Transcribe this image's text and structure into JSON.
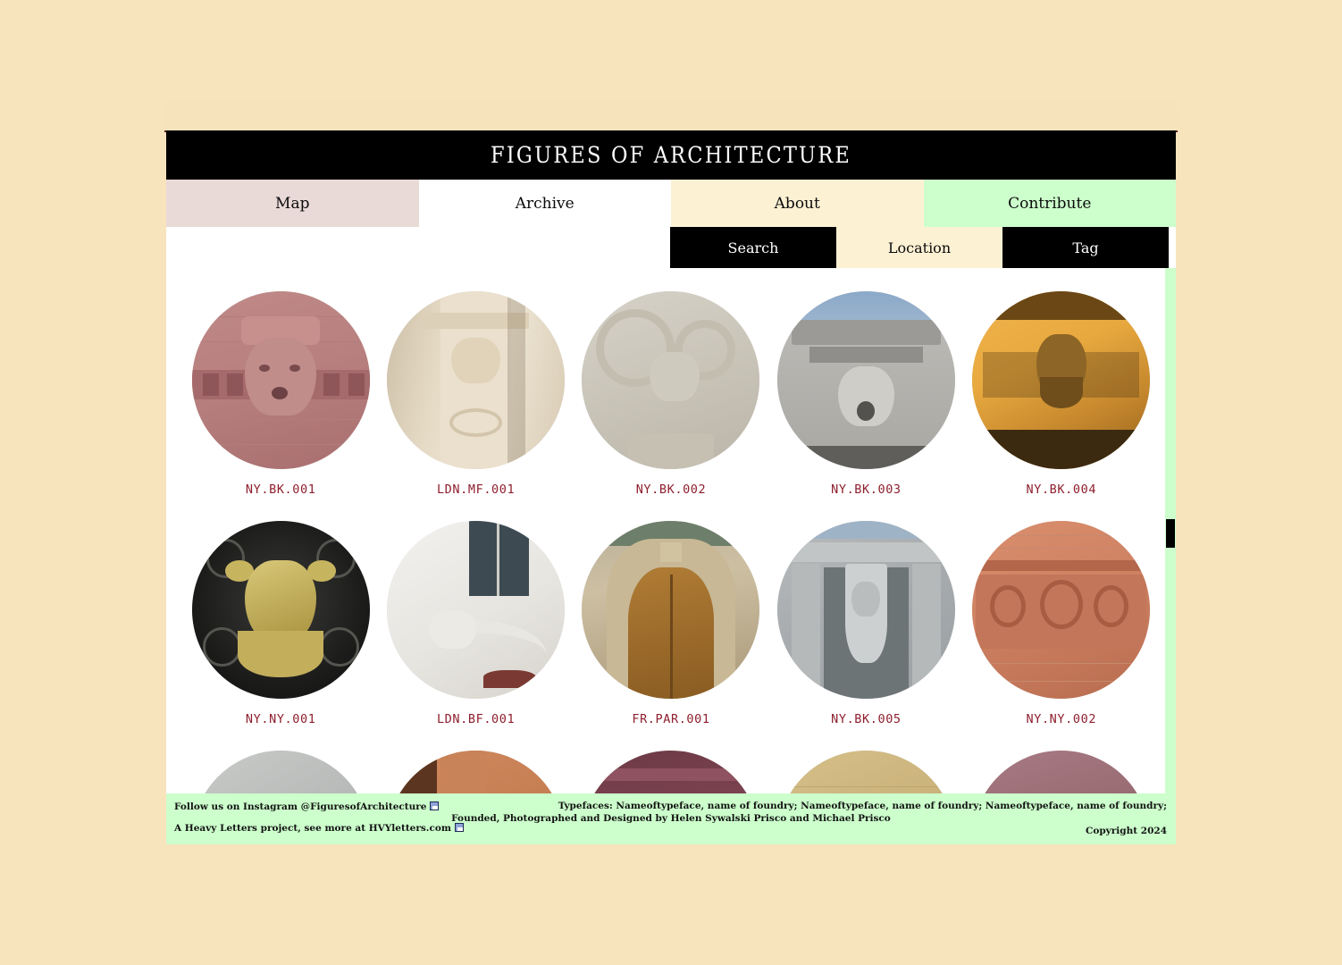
{
  "site": {
    "title": "FIGURES OF ARCHITECTURE"
  },
  "main_nav": [
    {
      "label": "Map",
      "state": "pink"
    },
    {
      "label": "Archive",
      "state": "white"
    },
    {
      "label": "About",
      "state": "cream"
    },
    {
      "label": "Contribute",
      "state": "mint"
    }
  ],
  "sub_nav": [
    {
      "label": "Search",
      "state": "black"
    },
    {
      "label": "Location",
      "state": "cream"
    },
    {
      "label": "Tag",
      "state": "black"
    }
  ],
  "archive": {
    "items": [
      {
        "label": "NY.BK.001"
      },
      {
        "label": "LDN.MF.001"
      },
      {
        "label": "NY.BK.002"
      },
      {
        "label": "NY.BK.003"
      },
      {
        "label": "NY.BK.004"
      },
      {
        "label": "NY.NY.001"
      },
      {
        "label": "LDN.BF.001"
      },
      {
        "label": "FR.PAR.001"
      },
      {
        "label": "NY.BK.005"
      },
      {
        "label": "NY.NY.002"
      }
    ]
  },
  "footer": {
    "instagram": "Follow us on Instagram @FiguresofArchitecture",
    "heavy_letters": "A Heavy Letters project, see more at HVYletters.com",
    "typefaces": "Typefaces: Nameoftypeface, name of foundry; Nameoftypeface, name of foundry; Nameoftypeface, name of foundry;",
    "founded": "Founded, Photographed and Designed by Helen Sywalski Prisco and Michael Prisco",
    "copyright": "Copyright 2024"
  },
  "colors": {
    "page_background": "#f7e3bc",
    "header_black": "#000000",
    "tab_pink": "#e9d9d7",
    "tab_cream": "#fdf1d4",
    "tab_mint": "#ccffcc",
    "label_red": "#8e1f2e",
    "footer_green": "#ccffcc"
  }
}
